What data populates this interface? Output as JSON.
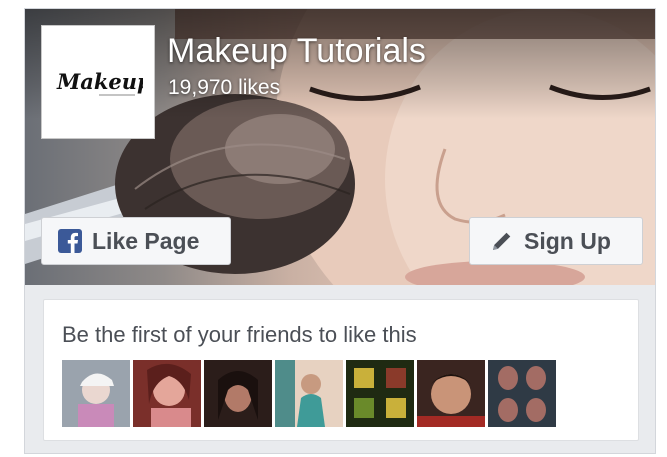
{
  "page": {
    "name": "Makeup Tutorials",
    "likes_text": "19,970 likes",
    "logo_text": "Makeup"
  },
  "actions": {
    "like_label": "Like Page",
    "signup_label": "Sign Up"
  },
  "friends": {
    "prompt": "Be the first of your friends to like this",
    "avatars": [
      {
        "name": "friend-avatar-1",
        "colors": [
          "#9aa3ad",
          "#c98ab9"
        ]
      },
      {
        "name": "friend-avatar-2",
        "colors": [
          "#7a2f2a",
          "#e4a69a"
        ]
      },
      {
        "name": "friend-avatar-3",
        "colors": [
          "#2b1d1a",
          "#b27a68"
        ]
      },
      {
        "name": "friend-avatar-4",
        "colors": [
          "#4f8c8a",
          "#e7d2c1"
        ]
      },
      {
        "name": "friend-avatar-5",
        "colors": [
          "#1f2a12",
          "#c9b03a"
        ]
      },
      {
        "name": "friend-avatar-6",
        "colors": [
          "#3a2520",
          "#c99478"
        ]
      },
      {
        "name": "friend-avatar-7",
        "colors": [
          "#2f3a45",
          "#a36c64"
        ]
      }
    ]
  },
  "colors": {
    "facebook_blue": "#3b5998",
    "button_bg": "#f6f7f9",
    "button_text": "#4b4f56"
  },
  "icons": {
    "like": "facebook-f-icon",
    "signup": "pencil-icon"
  }
}
